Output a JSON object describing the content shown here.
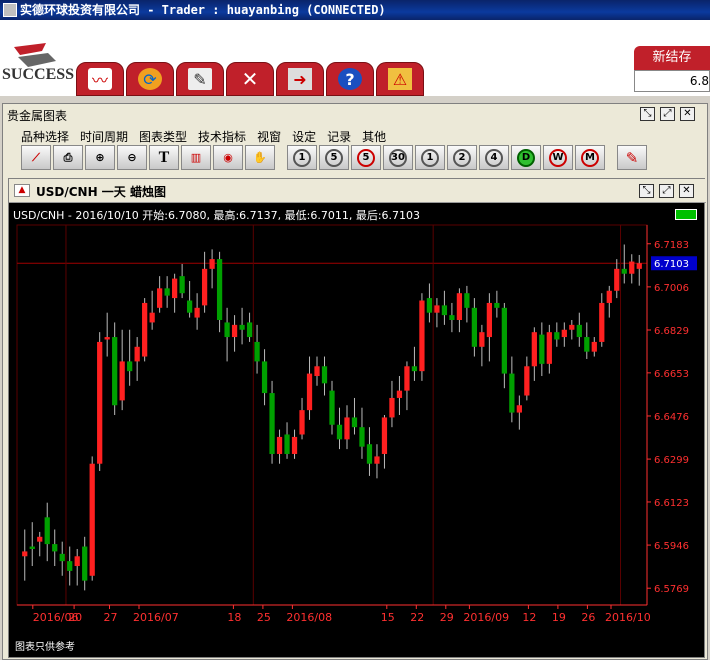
{
  "window": {
    "title": "实德环球投资有限公司 -  Trader : huayanbing (CONNECTED)"
  },
  "logo": {
    "text": "SUCCESS"
  },
  "top_toolbar": {
    "buttons": [
      "chart-icon",
      "refresh-icon",
      "order-icon",
      "tools-icon",
      "exit-icon",
      "help-icon",
      "alert-icon"
    ]
  },
  "settle": {
    "label": "新结存",
    "value": "6.8"
  },
  "panel": {
    "title": "贵金属图表"
  },
  "menu": {
    "items": [
      "品种选择",
      "时间周期",
      "图表类型",
      "技术指标",
      "视窗",
      "设定",
      "记录",
      "其他"
    ]
  },
  "toolbar": {
    "tools": [
      "line-chart-icon",
      "print-icon",
      "zoom-in-icon",
      "zoom-out-icon",
      "text-icon",
      "delete-icon",
      "eye-icon",
      "hand-icon"
    ],
    "periods": [
      "1",
      "5",
      "5",
      "30",
      "1",
      "2",
      "4",
      "D",
      "W",
      "M"
    ],
    "edit": "pencil-icon"
  },
  "chart_window": {
    "title": "USD/CNH 一天 蜡烛图"
  },
  "chart_info": "USD/CNH - 2016/10/10 开始:6.7080, 最高:6.7137, 最低:6.7011, 最后:6.7103",
  "footnote": "图表只供参考",
  "colors": {
    "up": "#ff2020",
    "down": "#00a000",
    "grid": "#5a0000",
    "axis": "#ff3030",
    "last_price_bg": "#0000cc"
  },
  "chart_data": {
    "type": "candlestick",
    "symbol": "USD/CNH",
    "period": "一天",
    "last": 6.7103,
    "y_ticks": [
      6.7183,
      6.7006,
      6.6829,
      6.6653,
      6.6476,
      6.6299,
      6.6123,
      6.5946,
      6.5769
    ],
    "ylim": [
      6.57,
      6.726
    ],
    "x_labels": [
      "2016/06",
      "20",
      "27",
      "2016/07",
      "18",
      "25",
      "2016/08",
      "15",
      "22",
      "29",
      "2016/09",
      "12",
      "19",
      "26",
      "2016/10"
    ],
    "candles": [
      {
        "o": 6.59,
        "h": 6.601,
        "l": 6.58,
        "c": 6.592
      },
      {
        "o": 6.594,
        "h": 6.604,
        "l": 6.586,
        "c": 6.593
      },
      {
        "o": 6.596,
        "h": 6.6,
        "l": 6.59,
        "c": 6.598
      },
      {
        "o": 6.606,
        "h": 6.612,
        "l": 6.588,
        "c": 6.595
      },
      {
        "o": 6.595,
        "h": 6.601,
        "l": 6.586,
        "c": 6.592
      },
      {
        "o": 6.591,
        "h": 6.596,
        "l": 6.582,
        "c": 6.588
      },
      {
        "o": 6.588,
        "h": 6.594,
        "l": 6.578,
        "c": 6.584
      },
      {
        "o": 6.586,
        "h": 6.593,
        "l": 6.578,
        "c": 6.59
      },
      {
        "o": 6.594,
        "h": 6.598,
        "l": 6.576,
        "c": 6.58
      },
      {
        "o": 6.582,
        "h": 6.631,
        "l": 6.58,
        "c": 6.628
      },
      {
        "o": 6.628,
        "h": 6.682,
        "l": 6.625,
        "c": 6.678
      },
      {
        "o": 6.679,
        "h": 6.69,
        "l": 6.672,
        "c": 6.68
      },
      {
        "o": 6.68,
        "h": 6.686,
        "l": 6.648,
        "c": 6.652
      },
      {
        "o": 6.654,
        "h": 6.683,
        "l": 6.65,
        "c": 6.67
      },
      {
        "o": 6.67,
        "h": 6.683,
        "l": 6.66,
        "c": 6.666
      },
      {
        "o": 6.67,
        "h": 6.68,
        "l": 6.662,
        "c": 6.676
      },
      {
        "o": 6.672,
        "h": 6.696,
        "l": 6.67,
        "c": 6.694
      },
      {
        "o": 6.686,
        "h": 6.699,
        "l": 6.683,
        "c": 6.69
      },
      {
        "o": 6.692,
        "h": 6.705,
        "l": 6.69,
        "c": 6.7
      },
      {
        "o": 6.7,
        "h": 6.705,
        "l": 6.692,
        "c": 6.697
      },
      {
        "o": 6.696,
        "h": 6.706,
        "l": 6.69,
        "c": 6.704
      },
      {
        "o": 6.705,
        "h": 6.71,
        "l": 6.696,
        "c": 6.698
      },
      {
        "o": 6.695,
        "h": 6.703,
        "l": 6.688,
        "c": 6.69
      },
      {
        "o": 6.688,
        "h": 6.698,
        "l": 6.683,
        "c": 6.692
      },
      {
        "o": 6.693,
        "h": 6.715,
        "l": 6.69,
        "c": 6.708
      },
      {
        "o": 6.708,
        "h": 6.716,
        "l": 6.7,
        "c": 6.712
      },
      {
        "o": 6.712,
        "h": 6.715,
        "l": 6.682,
        "c": 6.687
      },
      {
        "o": 6.686,
        "h": 6.692,
        "l": 6.67,
        "c": 6.68
      },
      {
        "o": 6.68,
        "h": 6.689,
        "l": 6.674,
        "c": 6.685
      },
      {
        "o": 6.685,
        "h": 6.692,
        "l": 6.677,
        "c": 6.683
      },
      {
        "o": 6.686,
        "h": 6.69,
        "l": 6.678,
        "c": 6.68
      },
      {
        "o": 6.678,
        "h": 6.685,
        "l": 6.665,
        "c": 6.67
      },
      {
        "o": 6.67,
        "h": 6.675,
        "l": 6.652,
        "c": 6.657
      },
      {
        "o": 6.657,
        "h": 6.662,
        "l": 6.628,
        "c": 6.632
      },
      {
        "o": 6.632,
        "h": 6.642,
        "l": 6.628,
        "c": 6.639
      },
      {
        "o": 6.64,
        "h": 6.645,
        "l": 6.63,
        "c": 6.632
      },
      {
        "o": 6.632,
        "h": 6.642,
        "l": 6.63,
        "c": 6.639
      },
      {
        "o": 6.64,
        "h": 6.655,
        "l": 6.638,
        "c": 6.65
      },
      {
        "o": 6.65,
        "h": 6.672,
        "l": 6.646,
        "c": 6.665
      },
      {
        "o": 6.664,
        "h": 6.672,
        "l": 6.66,
        "c": 6.668
      },
      {
        "o": 6.668,
        "h": 6.672,
        "l": 6.656,
        "c": 6.661
      },
      {
        "o": 6.658,
        "h": 6.662,
        "l": 6.64,
        "c": 6.644
      },
      {
        "o": 6.644,
        "h": 6.651,
        "l": 6.634,
        "c": 6.638
      },
      {
        "o": 6.638,
        "h": 6.652,
        "l": 6.634,
        "c": 6.647
      },
      {
        "o": 6.647,
        "h": 6.655,
        "l": 6.64,
        "c": 6.643
      },
      {
        "o": 6.643,
        "h": 6.651,
        "l": 6.63,
        "c": 6.635
      },
      {
        "o": 6.636,
        "h": 6.643,
        "l": 6.623,
        "c": 6.628
      },
      {
        "o": 6.628,
        "h": 6.636,
        "l": 6.622,
        "c": 6.631
      },
      {
        "o": 6.632,
        "h": 6.648,
        "l": 6.626,
        "c": 6.647
      },
      {
        "o": 6.647,
        "h": 6.662,
        "l": 6.643,
        "c": 6.655
      },
      {
        "o": 6.655,
        "h": 6.664,
        "l": 6.648,
        "c": 6.658
      },
      {
        "o": 6.658,
        "h": 6.67,
        "l": 6.65,
        "c": 6.668
      },
      {
        "o": 6.668,
        "h": 6.676,
        "l": 6.662,
        "c": 6.666
      },
      {
        "o": 6.666,
        "h": 6.698,
        "l": 6.662,
        "c": 6.695
      },
      {
        "o": 6.696,
        "h": 6.702,
        "l": 6.686,
        "c": 6.69
      },
      {
        "o": 6.69,
        "h": 6.696,
        "l": 6.684,
        "c": 6.693
      },
      {
        "o": 6.693,
        "h": 6.699,
        "l": 6.685,
        "c": 6.689
      },
      {
        "o": 6.689,
        "h": 6.694,
        "l": 6.682,
        "c": 6.687
      },
      {
        "o": 6.687,
        "h": 6.7,
        "l": 6.682,
        "c": 6.698
      },
      {
        "o": 6.698,
        "h": 6.701,
        "l": 6.686,
        "c": 6.692
      },
      {
        "o": 6.692,
        "h": 6.696,
        "l": 6.672,
        "c": 6.676
      },
      {
        "o": 6.676,
        "h": 6.685,
        "l": 6.668,
        "c": 6.682
      },
      {
        "o": 6.68,
        "h": 6.698,
        "l": 6.67,
        "c": 6.694
      },
      {
        "o": 6.694,
        "h": 6.699,
        "l": 6.688,
        "c": 6.692
      },
      {
        "o": 6.692,
        "h": 6.694,
        "l": 6.659,
        "c": 6.665
      },
      {
        "o": 6.665,
        "h": 6.672,
        "l": 6.645,
        "c": 6.649
      },
      {
        "o": 6.649,
        "h": 6.656,
        "l": 6.642,
        "c": 6.652
      },
      {
        "o": 6.656,
        "h": 6.672,
        "l": 6.654,
        "c": 6.668
      },
      {
        "o": 6.668,
        "h": 6.684,
        "l": 6.662,
        "c": 6.682
      },
      {
        "o": 6.681,
        "h": 6.686,
        "l": 6.664,
        "c": 6.669
      },
      {
        "o": 6.669,
        "h": 6.685,
        "l": 6.665,
        "c": 6.682
      },
      {
        "o": 6.682,
        "h": 6.686,
        "l": 6.676,
        "c": 6.679
      },
      {
        "o": 6.68,
        "h": 6.686,
        "l": 6.676,
        "c": 6.683
      },
      {
        "o": 6.683,
        "h": 6.687,
        "l": 6.679,
        "c": 6.685
      },
      {
        "o": 6.685,
        "h": 6.69,
        "l": 6.676,
        "c": 6.68
      },
      {
        "o": 6.68,
        "h": 6.686,
        "l": 6.671,
        "c": 6.674
      },
      {
        "o": 6.674,
        "h": 6.68,
        "l": 6.672,
        "c": 6.678
      },
      {
        "o": 6.678,
        "h": 6.698,
        "l": 6.676,
        "c": 6.694
      },
      {
        "o": 6.694,
        "h": 6.701,
        "l": 6.688,
        "c": 6.699
      },
      {
        "o": 6.699,
        "h": 6.712,
        "l": 6.696,
        "c": 6.708
      },
      {
        "o": 6.708,
        "h": 6.718,
        "l": 6.702,
        "c": 6.706
      },
      {
        "o": 6.706,
        "h": 6.714,
        "l": 6.702,
        "c": 6.711
      },
      {
        "o": 6.708,
        "h": 6.7137,
        "l": 6.7011,
        "c": 6.7103
      }
    ]
  }
}
